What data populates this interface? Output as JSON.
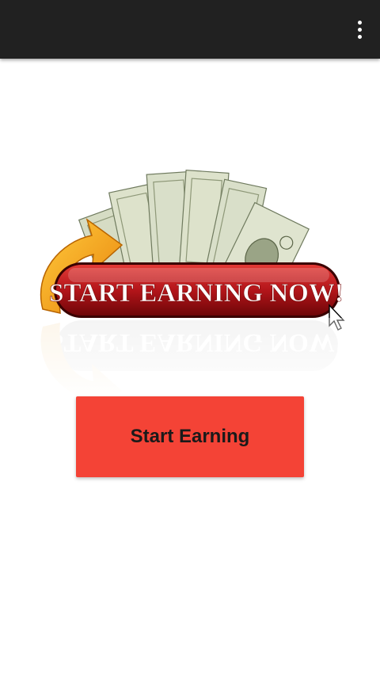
{
  "app_bar": {
    "overflow_icon": "more-vert-icon"
  },
  "banner": {
    "text": "START EARNING NOW!",
    "colors": {
      "pill": "#b3151a",
      "arrow": "#f7a21b",
      "bill": "#d9dfc9"
    }
  },
  "primary_button": {
    "label": "Start Earning",
    "color": "#f44336"
  }
}
